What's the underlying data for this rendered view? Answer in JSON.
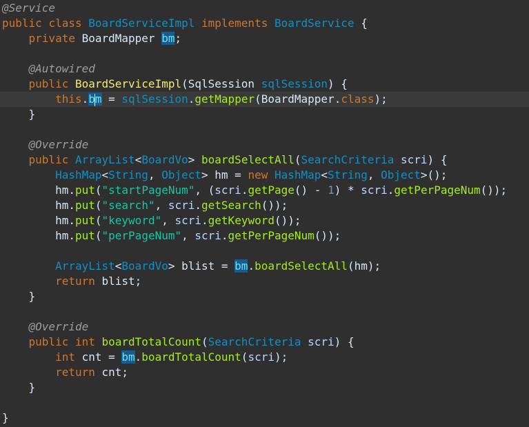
{
  "editor": {
    "lines": [
      [
        {
          "t": "@Service",
          "c": "ann"
        }
      ],
      [
        {
          "t": "public ",
          "c": "kw"
        },
        {
          "t": "class ",
          "c": "kw"
        },
        {
          "t": "BoardServiceImpl",
          "c": "type"
        },
        {
          "t": " ",
          "c": "op"
        },
        {
          "t": "implements ",
          "c": "kw"
        },
        {
          "t": "BoardService",
          "c": "type"
        },
        {
          "t": " {",
          "c": "op"
        }
      ],
      [
        {
          "t": "    private ",
          "c": "kw"
        },
        {
          "t": "BoardMapper ",
          "c": "id"
        },
        {
          "t": "bm",
          "c": "field",
          "hl": true
        },
        {
          "t": ";",
          "c": "op"
        }
      ],
      [],
      [
        {
          "t": "    @Autowired",
          "c": "ann"
        }
      ],
      [
        {
          "t": "    public ",
          "c": "kw"
        },
        {
          "t": "BoardServiceImpl",
          "c": "ctor"
        },
        {
          "t": "(",
          "c": "op"
        },
        {
          "t": "SqlSession ",
          "c": "id"
        },
        {
          "t": "sqlSession",
          "c": "type"
        },
        {
          "t": ") {",
          "c": "op"
        }
      ],
      [
        {
          "t": "        this",
          "c": "kw"
        },
        {
          "t": ".",
          "c": "op"
        },
        {
          "t": "b",
          "c": "field",
          "hl": true
        },
        {
          "t": "m",
          "c": "field",
          "hl": true,
          "cursor": true
        },
        {
          "t": " = ",
          "c": "op"
        },
        {
          "t": "sqlSession",
          "c": "type"
        },
        {
          "t": ".",
          "c": "op"
        },
        {
          "t": "getMapper",
          "c": "method"
        },
        {
          "t": "(BoardMapper.",
          "c": "op"
        },
        {
          "t": "class",
          "c": "kw"
        },
        {
          "t": ");",
          "c": "op"
        }
      ],
      [
        {
          "t": "    }",
          "c": "op"
        }
      ],
      [],
      [
        {
          "t": "    @Override",
          "c": "ann"
        }
      ],
      [
        {
          "t": "    public ",
          "c": "kw"
        },
        {
          "t": "ArrayList",
          "c": "type"
        },
        {
          "t": "<",
          "c": "op"
        },
        {
          "t": "BoardVo",
          "c": "type"
        },
        {
          "t": "> ",
          "c": "op"
        },
        {
          "t": "boardSelectAll",
          "c": "method"
        },
        {
          "t": "(",
          "c": "op"
        },
        {
          "t": "SearchCriteria ",
          "c": "type"
        },
        {
          "t": "scri",
          "c": "gen"
        },
        {
          "t": ") {",
          "c": "op"
        }
      ],
      [
        {
          "t": "        HashMap",
          "c": "type"
        },
        {
          "t": "<",
          "c": "op"
        },
        {
          "t": "String",
          "c": "type"
        },
        {
          "t": ", ",
          "c": "op"
        },
        {
          "t": "Object",
          "c": "type"
        },
        {
          "t": "> hm = ",
          "c": "op"
        },
        {
          "t": "new ",
          "c": "kw"
        },
        {
          "t": "HashMap",
          "c": "type"
        },
        {
          "t": "<",
          "c": "op"
        },
        {
          "t": "String",
          "c": "type"
        },
        {
          "t": ", ",
          "c": "op"
        },
        {
          "t": "Object",
          "c": "type"
        },
        {
          "t": ">();",
          "c": "op"
        }
      ],
      [
        {
          "t": "        hm.",
          "c": "op"
        },
        {
          "t": "put",
          "c": "method"
        },
        {
          "t": "(",
          "c": "op"
        },
        {
          "t": "\"startPageNum\"",
          "c": "str"
        },
        {
          "t": ", (",
          "c": "op"
        },
        {
          "t": "scri",
          "c": "gen"
        },
        {
          "t": ".",
          "c": "op"
        },
        {
          "t": "getPage",
          "c": "method"
        },
        {
          "t": "() - ",
          "c": "op"
        },
        {
          "t": "1",
          "c": "num"
        },
        {
          "t": ") * ",
          "c": "op"
        },
        {
          "t": "scri",
          "c": "gen"
        },
        {
          "t": ".",
          "c": "op"
        },
        {
          "t": "getPerPageNum",
          "c": "method"
        },
        {
          "t": "());",
          "c": "op"
        }
      ],
      [
        {
          "t": "        hm.",
          "c": "op"
        },
        {
          "t": "put",
          "c": "method"
        },
        {
          "t": "(",
          "c": "op"
        },
        {
          "t": "\"search\"",
          "c": "str"
        },
        {
          "t": ", ",
          "c": "op"
        },
        {
          "t": "scri",
          "c": "gen"
        },
        {
          "t": ".",
          "c": "op"
        },
        {
          "t": "getSearch",
          "c": "method"
        },
        {
          "t": "());",
          "c": "op"
        }
      ],
      [
        {
          "t": "        hm.",
          "c": "op"
        },
        {
          "t": "put",
          "c": "method"
        },
        {
          "t": "(",
          "c": "op"
        },
        {
          "t": "\"keyword\"",
          "c": "str"
        },
        {
          "t": ", ",
          "c": "op"
        },
        {
          "t": "scri",
          "c": "gen"
        },
        {
          "t": ".",
          "c": "op"
        },
        {
          "t": "getKeyword",
          "c": "method"
        },
        {
          "t": "());",
          "c": "op"
        }
      ],
      [
        {
          "t": "        hm.",
          "c": "op"
        },
        {
          "t": "put",
          "c": "method"
        },
        {
          "t": "(",
          "c": "op"
        },
        {
          "t": "\"perPageNum\"",
          "c": "str"
        },
        {
          "t": ", ",
          "c": "op"
        },
        {
          "t": "scri",
          "c": "gen"
        },
        {
          "t": ".",
          "c": "op"
        },
        {
          "t": "getPerPageNum",
          "c": "method"
        },
        {
          "t": "());",
          "c": "op"
        }
      ],
      [],
      [
        {
          "t": "        ArrayList",
          "c": "type"
        },
        {
          "t": "<",
          "c": "op"
        },
        {
          "t": "BoardVo",
          "c": "type"
        },
        {
          "t": "> blist = ",
          "c": "op"
        },
        {
          "t": "bm",
          "c": "field",
          "hl": true
        },
        {
          "t": ".",
          "c": "op"
        },
        {
          "t": "boardSelectAll",
          "c": "method"
        },
        {
          "t": "(hm);",
          "c": "op"
        }
      ],
      [
        {
          "t": "        return ",
          "c": "kw"
        },
        {
          "t": "blist;",
          "c": "op"
        }
      ],
      [
        {
          "t": "    }",
          "c": "op"
        }
      ],
      [],
      [
        {
          "t": "    @Override",
          "c": "ann"
        }
      ],
      [
        {
          "t": "    public ",
          "c": "kw"
        },
        {
          "t": "int ",
          "c": "kw"
        },
        {
          "t": "boardTotalCount",
          "c": "method"
        },
        {
          "t": "(",
          "c": "op"
        },
        {
          "t": "SearchCriteria ",
          "c": "type"
        },
        {
          "t": "scri",
          "c": "gen"
        },
        {
          "t": ") {",
          "c": "op"
        }
      ],
      [
        {
          "t": "        int ",
          "c": "kw"
        },
        {
          "t": "cnt = ",
          "c": "op"
        },
        {
          "t": "bm",
          "c": "field",
          "hl": true
        },
        {
          "t": ".",
          "c": "op"
        },
        {
          "t": "boardTotalCount",
          "c": "method"
        },
        {
          "t": "(",
          "c": "op"
        },
        {
          "t": "scri",
          "c": "gen"
        },
        {
          "t": ");",
          "c": "op"
        }
      ],
      [
        {
          "t": "        return ",
          "c": "kw"
        },
        {
          "t": "cnt;",
          "c": "op"
        }
      ],
      [
        {
          "t": "    }",
          "c": "op"
        }
      ],
      [],
      [
        {
          "t": "}",
          "c": "op"
        }
      ]
    ],
    "current_line_index": 6
  },
  "colors": {
    "background": "#2f2f2f",
    "current_line": "#3a3a3a",
    "keyword": "#cc7832",
    "annotation": "#9e9e9e",
    "type": "#1290c3",
    "string": "#17c6a3",
    "method": "#a7ec21",
    "field": "#66e1f8",
    "highlight": "#1a5b8a"
  }
}
